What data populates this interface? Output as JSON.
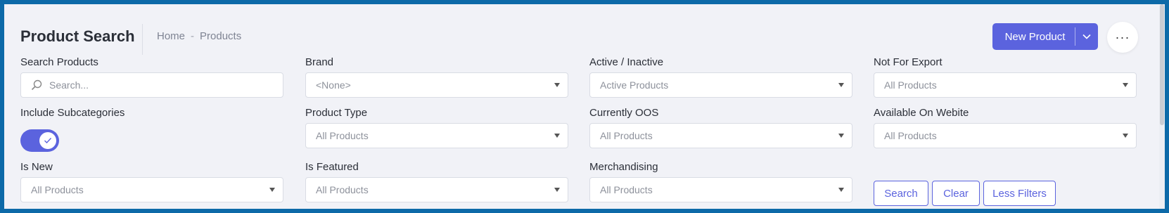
{
  "header": {
    "title": "Product Search",
    "breadcrumb": [
      "Home",
      "Products"
    ],
    "breadcrumb_separator": "-",
    "new_product_label": "New Product",
    "more_label": "···"
  },
  "filters": {
    "search_products": {
      "label": "Search Products",
      "placeholder": "Search..."
    },
    "brand": {
      "label": "Brand",
      "value": "<None>"
    },
    "active_inactive": {
      "label": "Active / Inactive",
      "value": "Active Products"
    },
    "not_for_export": {
      "label": "Not For Export",
      "value": "All Products"
    },
    "include_subcategories": {
      "label": "Include Subcategories",
      "checked": true
    },
    "product_type": {
      "label": "Product Type",
      "value": "All Products"
    },
    "currently_oos": {
      "label": "Currently OOS",
      "value": "All Products"
    },
    "available_on_website": {
      "label": "Available On Webite",
      "value": "All Products"
    },
    "is_new": {
      "label": "Is New",
      "value": "All Products"
    },
    "is_featured": {
      "label": "Is Featured",
      "value": "All Products"
    },
    "merchandising": {
      "label": "Merchandising",
      "value": "All Products"
    }
  },
  "actions": {
    "search_label": "Search",
    "clear_label": "Clear",
    "less_filters_label": "Less Filters"
  },
  "colors": {
    "accent": "#5b63de",
    "frame": "#0d6aa8",
    "background": "#f1f2f7"
  }
}
